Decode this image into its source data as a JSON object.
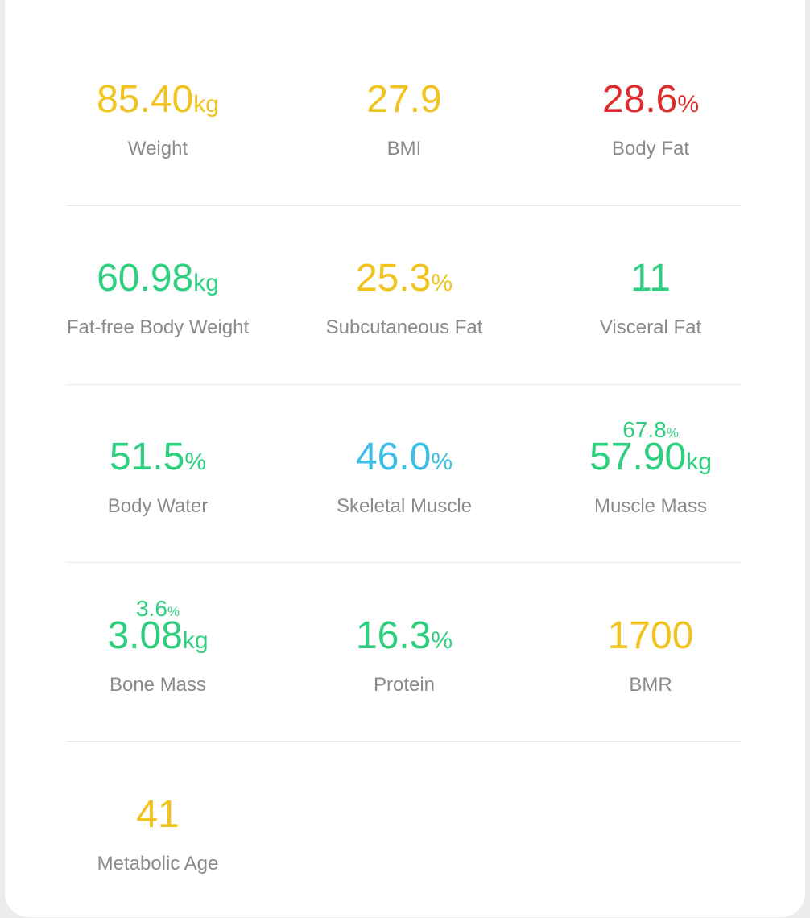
{
  "colors": {
    "yellow": "#f1c31e",
    "red": "#dc2b2b",
    "green": "#2ecf7f",
    "blue": "#3bbfe6",
    "label_gray": "#8a8a8a"
  },
  "metrics": [
    {
      "value": "85.40",
      "unit": "kg",
      "label": "Weight",
      "status": "yellow"
    },
    {
      "value": "27.9",
      "unit": "",
      "label": "BMI",
      "status": "yellow"
    },
    {
      "value": "28.6",
      "unit": "%",
      "label": "Body Fat",
      "status": "red"
    },
    {
      "value": "60.98",
      "unit": "kg",
      "label": "Fat-free Body Weight",
      "status": "green"
    },
    {
      "value": "25.3",
      "unit": "%",
      "label": "Subcutaneous Fat",
      "status": "yellow"
    },
    {
      "value": "11",
      "unit": "",
      "label": "Visceral Fat",
      "status": "green"
    },
    {
      "value": "51.5",
      "unit": "%",
      "label": "Body Water",
      "status": "green"
    },
    {
      "value": "46.0",
      "unit": "%",
      "label": "Skeletal Muscle",
      "status": "blue"
    },
    {
      "value": "57.90",
      "unit": "kg",
      "label": "Muscle Mass",
      "status": "green",
      "sub_value": "67.8",
      "sub_unit": "%"
    },
    {
      "value": "3.08",
      "unit": "kg",
      "label": "Bone Mass",
      "status": "green",
      "sub_value": "3.6",
      "sub_unit": "%"
    },
    {
      "value": "16.3",
      "unit": "%",
      "label": "Protein",
      "status": "green"
    },
    {
      "value": "1700",
      "unit": "",
      "label": "BMR",
      "status": "yellow"
    },
    {
      "value": "41",
      "unit": "",
      "label": "Metabolic Age",
      "status": "yellow"
    }
  ]
}
